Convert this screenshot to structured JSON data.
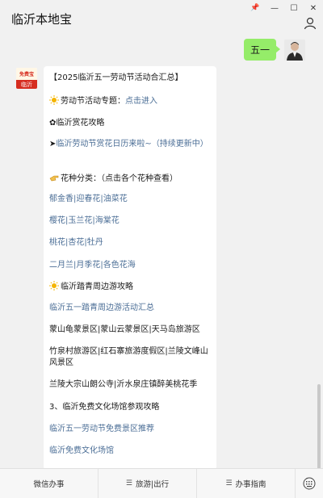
{
  "app": {
    "title": "临沂本地宝"
  },
  "window": {
    "pin": "📌",
    "minimize": "—",
    "maximize": "☐",
    "close": "✕"
  },
  "chat": {
    "user_message": "五一",
    "card_lines": [
      {
        "text": "【2025临沂五一劳动节活动合汇总】",
        "type": "text"
      },
      {
        "prefix": "劳动节活动专题：",
        "link": "点击进入",
        "type": "mixed",
        "icon": "sun-icon"
      },
      {
        "text": "✿临沂赏花攻略",
        "type": "text"
      },
      {
        "prefix": "➤",
        "link": "临沂劳动节赏花日历来啦~（持续更新中）",
        "type": "mixed"
      },
      {
        "text": "花种分类：（点击各个花种查看）",
        "type": "text",
        "icon": "hand-icon"
      },
      {
        "text": "郁金香|迎春花|油菜花",
        "type": "link"
      },
      {
        "text": "樱花|玉兰花|海棠花",
        "type": "link"
      },
      {
        "text": "桃花|杏花|牡丹",
        "type": "link"
      },
      {
        "text": "二月兰|月季花|各色花海",
        "type": "link"
      },
      {
        "text": "临沂踏青周边游攻略",
        "type": "text",
        "icon": "sun-icon"
      },
      {
        "text": "临沂五一踏青周边游活动汇总",
        "type": "link"
      },
      {
        "text": "蒙山龟蒙景区|蒙山云蒙景区|天马岛旅游区",
        "type": "text"
      },
      {
        "text": "竹泉村旅游区|红石寨旅游度假区|兰陵文峰山风景区",
        "type": "text"
      },
      {
        "text": "兰陵大宗山朗公寺|沂水泉庄镇醉美桃花季",
        "type": "text"
      },
      {
        "text": "3、临沂免费文化场馆参观攻略",
        "type": "text"
      },
      {
        "text": "临沂五一劳动节免费景区推荐",
        "type": "link"
      },
      {
        "text": "临沂免费文化场馆",
        "type": "link"
      }
    ]
  },
  "bot_logo": {
    "top": "免费宝",
    "bottom": "临沂"
  },
  "footer": {
    "items": [
      {
        "label": "微信办事"
      },
      {
        "label": "旅游|出行",
        "icon": "menu-icon"
      },
      {
        "label": "办事指南",
        "icon": "menu-icon"
      }
    ]
  },
  "colors": {
    "link": "#4b6e96",
    "bubble": "#95ec69",
    "background": "#f1f1f1"
  }
}
